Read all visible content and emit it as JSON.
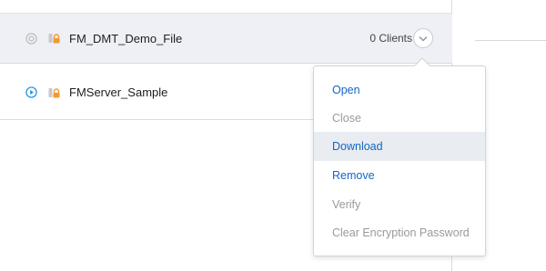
{
  "files": [
    {
      "name": "FM_DMT_Demo_File",
      "status_icon": "closed-circle-icon",
      "lock_icon": "encrypted-lock-icon",
      "clients": "0 Clients"
    },
    {
      "name": "FMServer_Sample",
      "status_icon": "play-circle-icon",
      "lock_icon": "encrypted-lock-icon"
    }
  ],
  "menu": {
    "items": [
      {
        "label": "Open",
        "state": "enabled"
      },
      {
        "label": "Close",
        "state": "disabled"
      },
      {
        "label": "Download",
        "state": "enabled",
        "hovered": true
      },
      {
        "label": "Remove",
        "state": "enabled"
      },
      {
        "label": "Verify",
        "state": "disabled"
      },
      {
        "label": "Clear Encryption Password",
        "state": "disabled"
      }
    ]
  },
  "colors": {
    "accent": "#1366c4",
    "disabled": "#9a9a9a",
    "selected_row": "#eef0f5",
    "lock_orange": "#f29a2e"
  }
}
